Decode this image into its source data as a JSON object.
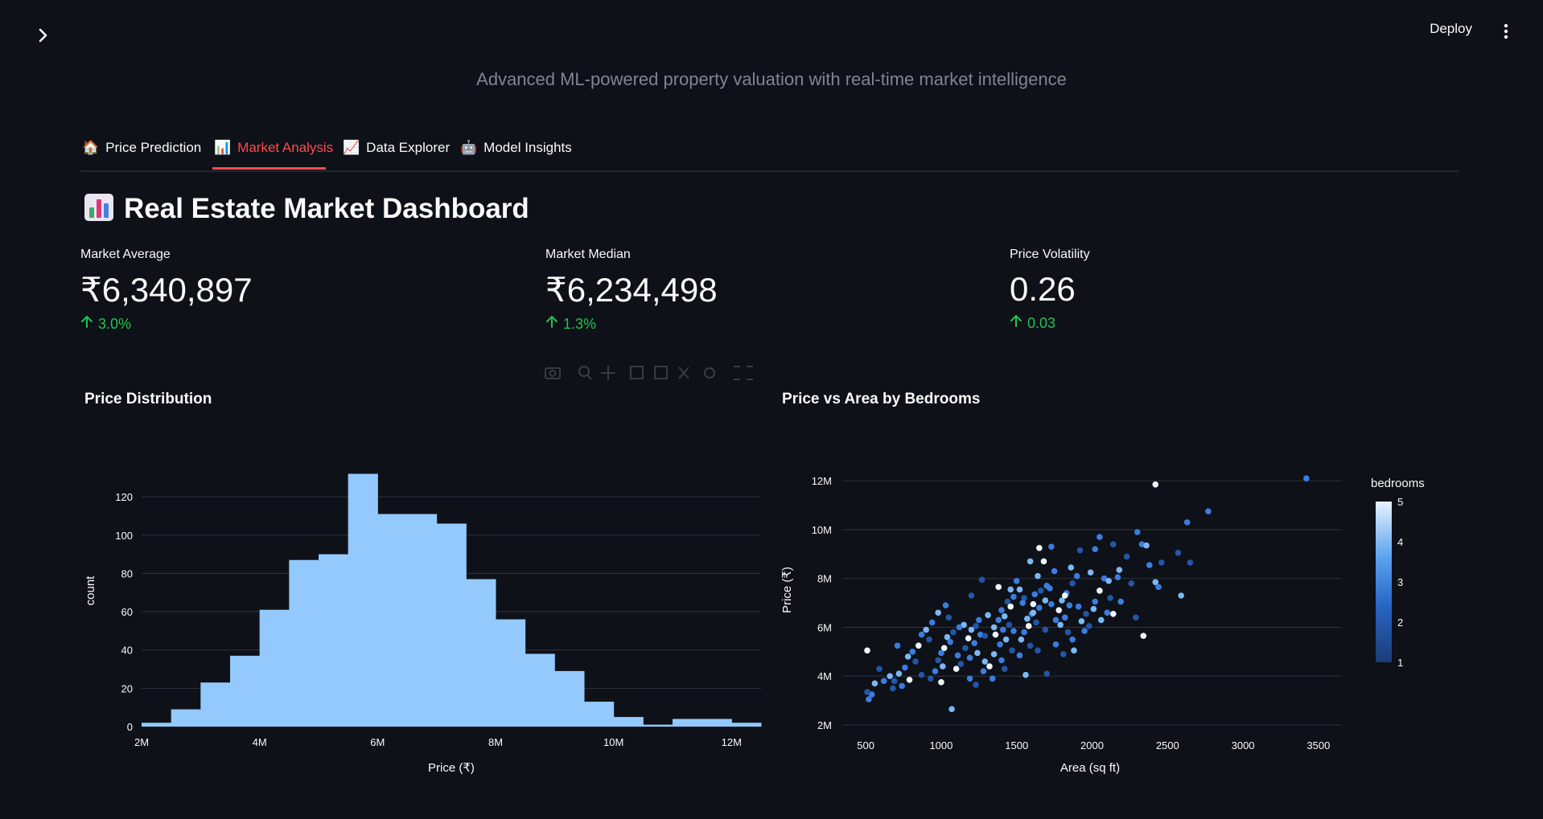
{
  "header": {
    "deploy_label": "Deploy",
    "subtitle": "Advanced ML-powered property valuation with real-time market intelligence"
  },
  "tabs": [
    {
      "icon": "🏠",
      "label": "Price Prediction"
    },
    {
      "icon": "📊",
      "label": "Market Analysis",
      "active": true
    },
    {
      "icon": "📈",
      "label": "Data Explorer"
    },
    {
      "icon": "🤖",
      "label": "Model Insights"
    }
  ],
  "dashboard": {
    "title": "Real Estate Market Dashboard"
  },
  "metrics": [
    {
      "label": "Market Average",
      "value": "₹6,340,897",
      "delta": "3.0%"
    },
    {
      "label": "Market Median",
      "value": "₹6,234,498",
      "delta": "1.3%"
    },
    {
      "label": "Price Volatility",
      "value": "0.26",
      "delta": "0.03"
    }
  ],
  "colors": {
    "background": "#0e1117",
    "accent": "#ff4b4b",
    "delta_positive": "#21c354",
    "histogram_bar": "#93c9fd"
  },
  "chart_data": [
    {
      "type": "bar",
      "title": "Price Distribution",
      "xlabel": "Price (₹)",
      "ylabel": "count",
      "xlim": [
        2000000,
        12500000
      ],
      "ylim": [
        0,
        136
      ],
      "xticks": [
        2000000,
        4000000,
        6000000,
        8000000,
        10000000,
        12000000
      ],
      "xtick_labels": [
        "2M",
        "4M",
        "6M",
        "8M",
        "10M",
        "12M"
      ],
      "yticks": [
        0,
        20,
        40,
        60,
        80,
        100,
        120
      ],
      "bin_width": 500000,
      "bin_starts": [
        2000000,
        2500000,
        3000000,
        3500000,
        4000000,
        4500000,
        5000000,
        5500000,
        6000000,
        6500000,
        7000000,
        7500000,
        8000000,
        8500000,
        9000000,
        9500000,
        10000000,
        10500000,
        11000000,
        11500000,
        12000000
      ],
      "values": [
        2,
        9,
        23,
        37,
        61,
        87,
        90,
        132,
        111,
        111,
        106,
        77,
        56,
        38,
        29,
        13,
        5,
        1,
        4,
        4,
        2
      ],
      "grid": true
    },
    {
      "type": "scatter",
      "title": "Price vs Area by Bedrooms",
      "xlabel": "Area (sq ft)",
      "ylabel": "Price (₹)",
      "xlim": [
        350,
        3650
      ],
      "ylim": [
        2000000,
        12600000
      ],
      "xticks": [
        500,
        1000,
        1500,
        2000,
        2500,
        3000,
        3500
      ],
      "yticks": [
        2000000,
        4000000,
        6000000,
        8000000,
        10000000,
        12000000
      ],
      "ytick_labels": [
        "2M",
        "4M",
        "6M",
        "8M",
        "10M",
        "12M"
      ],
      "colorbar": {
        "title": "bedrooms",
        "min": 1,
        "max": 5,
        "ticks": [
          1,
          2,
          3,
          4,
          5
        ]
      },
      "grid": true,
      "points": [
        [
          3420,
          12100000,
          3
        ],
        [
          2420,
          11850000,
          5
        ],
        [
          2770,
          10750000,
          3
        ],
        [
          2630,
          10300000,
          3
        ],
        [
          2300,
          9900000,
          3
        ],
        [
          2570,
          9050000,
          2
        ],
        [
          2650,
          8650000,
          2
        ],
        [
          2330,
          9400000,
          3
        ],
        [
          2230,
          8900000,
          2
        ],
        [
          2460,
          8650000,
          2
        ],
        [
          2360,
          9350000,
          4
        ],
        [
          2420,
          7850000,
          4
        ],
        [
          2440,
          7650000,
          3
        ],
        [
          2590,
          7300000,
          4
        ],
        [
          2290,
          6400000,
          2
        ],
        [
          2340,
          5650000,
          5
        ],
        [
          2050,
          9700000,
          3
        ],
        [
          2140,
          9400000,
          2
        ],
        [
          2020,
          9200000,
          3
        ],
        [
          1990,
          8250000,
          4
        ],
        [
          2080,
          8000000,
          3
        ],
        [
          2110,
          7900000,
          4
        ],
        [
          2170,
          8050000,
          3
        ],
        [
          2050,
          7500000,
          5
        ],
        [
          2120,
          7200000,
          2
        ],
        [
          2020,
          7050000,
          3
        ],
        [
          2100,
          6600000,
          3
        ],
        [
          2060,
          6300000,
          4
        ],
        [
          2140,
          6550000,
          5
        ],
        [
          1980,
          6050000,
          2
        ],
        [
          1950,
          5850000,
          3
        ],
        [
          1860,
          8450000,
          4
        ],
        [
          1900,
          8100000,
          3
        ],
        [
          1870,
          7800000,
          2
        ],
        [
          1830,
          7400000,
          3
        ],
        [
          1800,
          7100000,
          4
        ],
        [
          1850,
          6900000,
          3
        ],
        [
          1780,
          6700000,
          5
        ],
        [
          1820,
          6400000,
          3
        ],
        [
          1790,
          6100000,
          4
        ],
        [
          1840,
          5800000,
          2
        ],
        [
          1870,
          5500000,
          3
        ],
        [
          1880,
          5050000,
          4
        ],
        [
          1810,
          4900000,
          2
        ],
        [
          1730,
          9300000,
          3
        ],
        [
          1680,
          8700000,
          5
        ],
        [
          1750,
          8300000,
          3
        ],
        [
          1640,
          8100000,
          4
        ],
        [
          1700,
          7700000,
          3
        ],
        [
          1660,
          7500000,
          2
        ],
        [
          1620,
          7350000,
          3
        ],
        [
          1690,
          7100000,
          4
        ],
        [
          1610,
          6950000,
          5
        ],
        [
          1650,
          6800000,
          3
        ],
        [
          1600,
          6550000,
          3
        ],
        [
          1570,
          6350000,
          4
        ],
        [
          1630,
          6200000,
          2
        ],
        [
          1580,
          6050000,
          5
        ],
        [
          1550,
          5800000,
          3
        ],
        [
          1530,
          5500000,
          4
        ],
        [
          1590,
          5250000,
          2
        ],
        [
          1700,
          4100000,
          2
        ],
        [
          1560,
          4050000,
          4
        ],
        [
          1500,
          7900000,
          3
        ],
        [
          1520,
          7550000,
          4
        ],
        [
          1480,
          7250000,
          3
        ],
        [
          1440,
          7050000,
          2
        ],
        [
          1460,
          6850000,
          5
        ],
        [
          1400,
          6700000,
          3
        ],
        [
          1420,
          6450000,
          4
        ],
        [
          1380,
          6300000,
          3
        ],
        [
          1450,
          6100000,
          2
        ],
        [
          1410,
          5900000,
          3
        ],
        [
          1360,
          5700000,
          5
        ],
        [
          1430,
          5500000,
          4
        ],
        [
          1390,
          5300000,
          3
        ],
        [
          1470,
          5050000,
          2
        ],
        [
          1350,
          4900000,
          4
        ],
        [
          1400,
          4650000,
          3
        ],
        [
          1320,
          4400000,
          5
        ],
        [
          1280,
          4200000,
          3
        ],
        [
          1310,
          6500000,
          4
        ],
        [
          1250,
          6300000,
          3
        ],
        [
          1230,
          6050000,
          2
        ],
        [
          1200,
          5900000,
          4
        ],
        [
          1260,
          5700000,
          3
        ],
        [
          1180,
          5550000,
          5
        ],
        [
          1220,
          5350000,
          3
        ],
        [
          1160,
          5150000,
          2
        ],
        [
          1240,
          4950000,
          4
        ],
        [
          1190,
          4750000,
          3
        ],
        [
          1130,
          4500000,
          2
        ],
        [
          1100,
          4300000,
          5
        ],
        [
          1150,
          6100000,
          4
        ],
        [
          1120,
          6000000,
          3
        ],
        [
          1080,
          5800000,
          2
        ],
        [
          1040,
          5600000,
          4
        ],
        [
          1060,
          5400000,
          3
        ],
        [
          1020,
          5150000,
          5
        ],
        [
          1000,
          4950000,
          3
        ],
        [
          980,
          4650000,
          2
        ],
        [
          1010,
          4400000,
          4
        ],
        [
          960,
          4200000,
          3
        ],
        [
          930,
          3900000,
          2
        ],
        [
          1030,
          6900000,
          3
        ],
        [
          980,
          6600000,
          4
        ],
        [
          1050,
          6400000,
          2
        ],
        [
          940,
          6200000,
          3
        ],
        [
          900,
          5900000,
          4
        ],
        [
          870,
          5700000,
          3
        ],
        [
          920,
          5500000,
          2
        ],
        [
          850,
          5250000,
          5
        ],
        [
          810,
          5000000,
          3
        ],
        [
          780,
          4800000,
          4
        ],
        [
          830,
          4600000,
          2
        ],
        [
          760,
          4350000,
          3
        ],
        [
          720,
          4100000,
          4
        ],
        [
          690,
          3800000,
          2
        ],
        [
          740,
          3600000,
          3
        ],
        [
          680,
          3500000,
          2
        ],
        [
          620,
          3800000,
          3
        ],
        [
          560,
          3700000,
          4
        ],
        [
          540,
          3250000,
          3
        ],
        [
          510,
          3350000,
          2
        ],
        [
          520,
          3050000,
          3
        ],
        [
          510,
          5050000,
          5
        ],
        [
          590,
          4300000,
          2
        ],
        [
          660,
          4000000,
          4
        ],
        [
          1070,
          2650000,
          4
        ],
        [
          1650,
          9250000,
          5
        ],
        [
          1920,
          9150000,
          2
        ],
        [
          1590,
          8700000,
          4
        ],
        [
          1720,
          7600000,
          3
        ],
        [
          1550,
          7200000,
          2
        ],
        [
          1760,
          6300000,
          3
        ],
        [
          1930,
          6250000,
          4
        ],
        [
          1690,
          5900000,
          2
        ],
        [
          1480,
          5850000,
          3
        ],
        [
          1350,
          6000000,
          4
        ],
        [
          1290,
          5650000,
          2
        ],
        [
          1110,
          4850000,
          3
        ],
        [
          870,
          4050000,
          2
        ],
        [
          790,
          3850000,
          5
        ],
        [
          710,
          5250000,
          3
        ],
        [
          1200,
          7300000,
          2
        ],
        [
          1270,
          7950000,
          2
        ],
        [
          1380,
          7650000,
          5
        ],
        [
          1460,
          7550000,
          4
        ],
        [
          1540,
          7000000,
          3
        ],
        [
          1610,
          6600000,
          4
        ],
        [
          1730,
          6950000,
          3
        ],
        [
          1820,
          7300000,
          5
        ],
        [
          1910,
          6850000,
          3
        ],
        [
          1960,
          6550000,
          2
        ],
        [
          2010,
          6750000,
          4
        ],
        [
          2190,
          7050000,
          3
        ],
        [
          2260,
          7800000,
          2
        ],
        [
          2380,
          8550000,
          3
        ],
        [
          2180,
          8350000,
          4
        ],
        [
          1760,
          5300000,
          3
        ],
        [
          1640,
          5050000,
          2
        ],
        [
          1520,
          4850000,
          3
        ],
        [
          1290,
          4600000,
          4
        ],
        [
          1190,
          3900000,
          3
        ],
        [
          1230,
          3650000,
          2
        ],
        [
          1000,
          3750000,
          5
        ],
        [
          1340,
          3900000,
          3
        ],
        [
          1420,
          4300000,
          2
        ]
      ]
    }
  ]
}
